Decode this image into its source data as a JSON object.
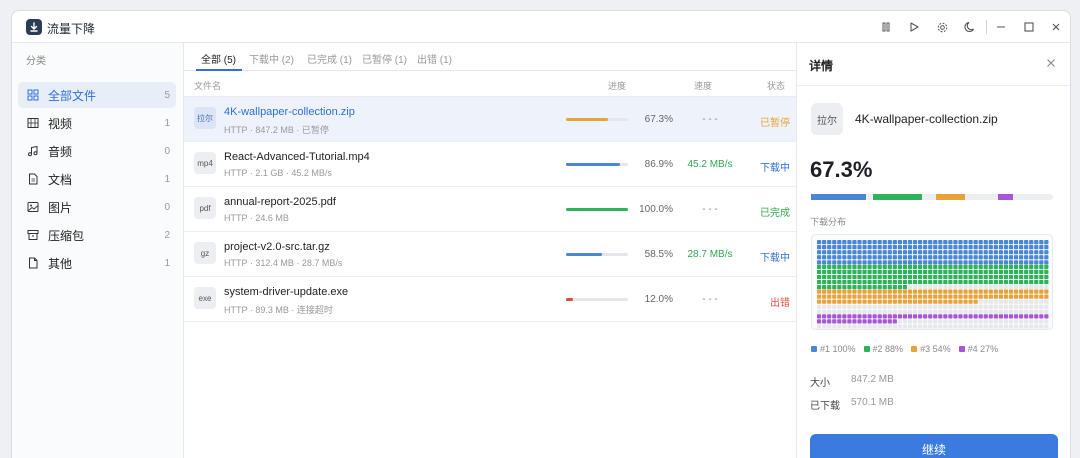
{
  "app": {
    "title": "流量下降"
  },
  "sidebar": {
    "heading": "分类",
    "items": [
      {
        "label": "全部文件",
        "count": "5",
        "icon": "grid-icon",
        "active": true
      },
      {
        "label": "视频",
        "count": "1",
        "icon": "video-icon"
      },
      {
        "label": "音频",
        "count": "0",
        "icon": "music-icon"
      },
      {
        "label": "文档",
        "count": "1",
        "icon": "document-icon"
      },
      {
        "label": "图片",
        "count": "0",
        "icon": "image-icon"
      },
      {
        "label": "压缩包",
        "count": "2",
        "icon": "archive-icon"
      },
      {
        "label": "其他",
        "count": "1",
        "icon": "file-icon"
      }
    ]
  },
  "tabs": [
    {
      "label": "全部 (5)",
      "active": true
    },
    {
      "label": "下载中 (2)"
    },
    {
      "label": "已完成 (1)"
    },
    {
      "label": "已暂停 (1)"
    },
    {
      "label": "出错 (1)"
    }
  ],
  "columns": {
    "name": "文件名",
    "progress": "进度",
    "speed": "速度",
    "status": "状态"
  },
  "rows": [
    {
      "type": "拉尔",
      "name": "4K-wallpaper-collection.zip",
      "meta": "HTTP · 847.2 MB · 已暂停",
      "progress": 0.673,
      "pct": "67.3%",
      "speed": "- - -",
      "status": "已暂停",
      "bar_color": "#e8a23a",
      "status_color": "#e8a23a",
      "speed_color": "#888888",
      "selected": true
    },
    {
      "type": "mp4",
      "name": "React-Advanced-Tutorial.mp4",
      "meta": "HTTP · 2.1 GB · 45.2 MB/s",
      "progress": 0.869,
      "pct": "86.9%",
      "speed": "45.2 MB/s",
      "status": "下载中",
      "bar_color": "#4a86d6",
      "status_color": "#2f6fd6",
      "speed_color": "#2fa84f"
    },
    {
      "type": "pdf",
      "name": "annual-report-2025.pdf",
      "meta": "HTTP · 24.6 MB",
      "progress": 1.0,
      "pct": "100.0%",
      "speed": "- - -",
      "status": "已完成",
      "bar_color": "#2fb35a",
      "status_color": "#2fa84f",
      "speed_color": "#888888"
    },
    {
      "type": "gz",
      "name": "project-v2.0-src.tar.gz",
      "meta": "HTTP · 312.4 MB · 28.7 MB/s",
      "progress": 0.585,
      "pct": "58.5%",
      "speed": "28.7 MB/s",
      "status": "下载中",
      "bar_color": "#4a86d6",
      "status_color": "#2f6fd6",
      "speed_color": "#2fa84f"
    },
    {
      "type": "exe",
      "name": "system-driver-update.exe",
      "meta": "HTTP · 89.3 MB · 连接超时",
      "progress": 0.12,
      "pct": "12.0%",
      "speed": "- - -",
      "status": "出错",
      "bar_color": "#e04a3a",
      "status_color": "#e0503f",
      "speed_color": "#888888"
    }
  ],
  "detail": {
    "title": "详情",
    "file_icon": "拉尔",
    "file_name": "4K-wallpaper-collection.zip",
    "percent": "67.3%",
    "segments": [
      {
        "color": "#4a86d6",
        "fill": 1.0
      },
      {
        "color": "#2fb35a",
        "fill": 0.88
      },
      {
        "color": "#e8a23a",
        "fill": 0.54
      },
      {
        "color": "#a855d6",
        "fill": 0.27
      }
    ],
    "dist_label": "下载分布",
    "legend": [
      {
        "label": "#1 100%",
        "color": "#4a86d6"
      },
      {
        "label": "#2 88%",
        "color": "#2fb35a"
      },
      {
        "label": "#3 54%",
        "color": "#e8a23a"
      },
      {
        "label": "#4 27%",
        "color": "#a855d6"
      }
    ],
    "size_label": "大小",
    "size_value": "847.2 MB",
    "downloaded_label": "已下载",
    "downloaded_value": "570.1 MB",
    "button": "继续"
  }
}
